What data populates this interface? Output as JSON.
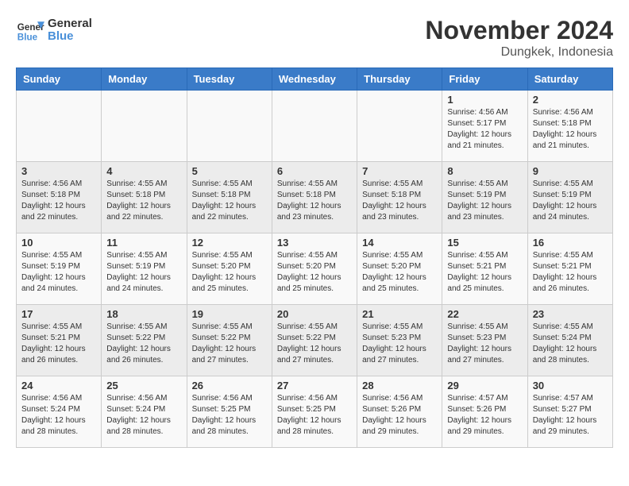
{
  "logo": {
    "line1": "General",
    "line2": "Blue"
  },
  "title": "November 2024",
  "location": "Dungkek, Indonesia",
  "weekdays": [
    "Sunday",
    "Monday",
    "Tuesday",
    "Wednesday",
    "Thursday",
    "Friday",
    "Saturday"
  ],
  "weeks": [
    [
      {
        "day": "",
        "info": ""
      },
      {
        "day": "",
        "info": ""
      },
      {
        "day": "",
        "info": ""
      },
      {
        "day": "",
        "info": ""
      },
      {
        "day": "",
        "info": ""
      },
      {
        "day": "1",
        "info": "Sunrise: 4:56 AM\nSunset: 5:17 PM\nDaylight: 12 hours\nand 21 minutes."
      },
      {
        "day": "2",
        "info": "Sunrise: 4:56 AM\nSunset: 5:18 PM\nDaylight: 12 hours\nand 21 minutes."
      }
    ],
    [
      {
        "day": "3",
        "info": "Sunrise: 4:56 AM\nSunset: 5:18 PM\nDaylight: 12 hours\nand 22 minutes."
      },
      {
        "day": "4",
        "info": "Sunrise: 4:55 AM\nSunset: 5:18 PM\nDaylight: 12 hours\nand 22 minutes."
      },
      {
        "day": "5",
        "info": "Sunrise: 4:55 AM\nSunset: 5:18 PM\nDaylight: 12 hours\nand 22 minutes."
      },
      {
        "day": "6",
        "info": "Sunrise: 4:55 AM\nSunset: 5:18 PM\nDaylight: 12 hours\nand 23 minutes."
      },
      {
        "day": "7",
        "info": "Sunrise: 4:55 AM\nSunset: 5:18 PM\nDaylight: 12 hours\nand 23 minutes."
      },
      {
        "day": "8",
        "info": "Sunrise: 4:55 AM\nSunset: 5:19 PM\nDaylight: 12 hours\nand 23 minutes."
      },
      {
        "day": "9",
        "info": "Sunrise: 4:55 AM\nSunset: 5:19 PM\nDaylight: 12 hours\nand 24 minutes."
      }
    ],
    [
      {
        "day": "10",
        "info": "Sunrise: 4:55 AM\nSunset: 5:19 PM\nDaylight: 12 hours\nand 24 minutes."
      },
      {
        "day": "11",
        "info": "Sunrise: 4:55 AM\nSunset: 5:19 PM\nDaylight: 12 hours\nand 24 minutes."
      },
      {
        "day": "12",
        "info": "Sunrise: 4:55 AM\nSunset: 5:20 PM\nDaylight: 12 hours\nand 25 minutes."
      },
      {
        "day": "13",
        "info": "Sunrise: 4:55 AM\nSunset: 5:20 PM\nDaylight: 12 hours\nand 25 minutes."
      },
      {
        "day": "14",
        "info": "Sunrise: 4:55 AM\nSunset: 5:20 PM\nDaylight: 12 hours\nand 25 minutes."
      },
      {
        "day": "15",
        "info": "Sunrise: 4:55 AM\nSunset: 5:21 PM\nDaylight: 12 hours\nand 25 minutes."
      },
      {
        "day": "16",
        "info": "Sunrise: 4:55 AM\nSunset: 5:21 PM\nDaylight: 12 hours\nand 26 minutes."
      }
    ],
    [
      {
        "day": "17",
        "info": "Sunrise: 4:55 AM\nSunset: 5:21 PM\nDaylight: 12 hours\nand 26 minutes."
      },
      {
        "day": "18",
        "info": "Sunrise: 4:55 AM\nSunset: 5:22 PM\nDaylight: 12 hours\nand 26 minutes."
      },
      {
        "day": "19",
        "info": "Sunrise: 4:55 AM\nSunset: 5:22 PM\nDaylight: 12 hours\nand 27 minutes."
      },
      {
        "day": "20",
        "info": "Sunrise: 4:55 AM\nSunset: 5:22 PM\nDaylight: 12 hours\nand 27 minutes."
      },
      {
        "day": "21",
        "info": "Sunrise: 4:55 AM\nSunset: 5:23 PM\nDaylight: 12 hours\nand 27 minutes."
      },
      {
        "day": "22",
        "info": "Sunrise: 4:55 AM\nSunset: 5:23 PM\nDaylight: 12 hours\nand 27 minutes."
      },
      {
        "day": "23",
        "info": "Sunrise: 4:55 AM\nSunset: 5:24 PM\nDaylight: 12 hours\nand 28 minutes."
      }
    ],
    [
      {
        "day": "24",
        "info": "Sunrise: 4:56 AM\nSunset: 5:24 PM\nDaylight: 12 hours\nand 28 minutes."
      },
      {
        "day": "25",
        "info": "Sunrise: 4:56 AM\nSunset: 5:24 PM\nDaylight: 12 hours\nand 28 minutes."
      },
      {
        "day": "26",
        "info": "Sunrise: 4:56 AM\nSunset: 5:25 PM\nDaylight: 12 hours\nand 28 minutes."
      },
      {
        "day": "27",
        "info": "Sunrise: 4:56 AM\nSunset: 5:25 PM\nDaylight: 12 hours\nand 28 minutes."
      },
      {
        "day": "28",
        "info": "Sunrise: 4:56 AM\nSunset: 5:26 PM\nDaylight: 12 hours\nand 29 minutes."
      },
      {
        "day": "29",
        "info": "Sunrise: 4:57 AM\nSunset: 5:26 PM\nDaylight: 12 hours\nand 29 minutes."
      },
      {
        "day": "30",
        "info": "Sunrise: 4:57 AM\nSunset: 5:27 PM\nDaylight: 12 hours\nand 29 minutes."
      }
    ]
  ]
}
